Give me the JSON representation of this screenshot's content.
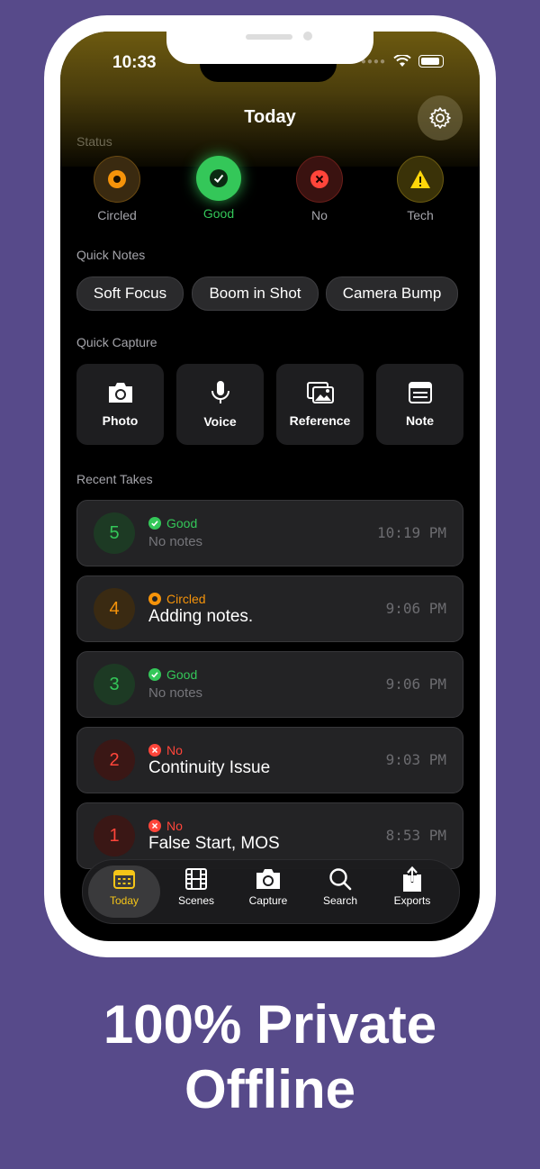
{
  "status_bar": {
    "time": "10:33"
  },
  "header": {
    "title": "Today"
  },
  "status_section": {
    "label": "Status",
    "items": [
      {
        "label": "Circled",
        "color": "#f5930a",
        "icon": "circle-dot-icon"
      },
      {
        "label": "Good",
        "color": "#34c759",
        "icon": "checkmark-icon",
        "selected": true
      },
      {
        "label": "No",
        "color": "#ff453a",
        "icon": "x-icon"
      },
      {
        "label": "Tech",
        "color": "#ffd60a",
        "icon": "warning-icon"
      }
    ]
  },
  "quick_notes": {
    "label": "Quick Notes",
    "chips": [
      "Soft Focus",
      "Boom in Shot",
      "Camera Bump"
    ]
  },
  "quick_capture": {
    "label": "Quick Capture",
    "items": [
      {
        "label": "Photo",
        "icon": "camera-icon"
      },
      {
        "label": "Voice",
        "icon": "microphone-icon"
      },
      {
        "label": "Reference",
        "icon": "photos-icon"
      },
      {
        "label": "Note",
        "icon": "note-icon"
      }
    ]
  },
  "recent_takes": {
    "label": "Recent Takes",
    "items": [
      {
        "number": "5",
        "status": "Good",
        "note": "No notes",
        "time": "10:19 PM",
        "color": "#34c759"
      },
      {
        "number": "4",
        "status": "Circled",
        "note": "Adding notes.",
        "time": "9:06 PM",
        "color": "#f5930a"
      },
      {
        "number": "3",
        "status": "Good",
        "note": "No notes",
        "time": "9:06 PM",
        "color": "#34c759"
      },
      {
        "number": "2",
        "status": "No",
        "note": "Continuity Issue",
        "time": "9:03 PM",
        "color": "#ff453a"
      },
      {
        "number": "1",
        "status": "No",
        "note": "False Start, MOS",
        "time": "8:53 PM",
        "color": "#ff453a"
      }
    ]
  },
  "tabbar": {
    "tabs": [
      {
        "label": "Today",
        "icon": "calendar-icon",
        "active": true
      },
      {
        "label": "Scenes",
        "icon": "film-icon"
      },
      {
        "label": "Capture",
        "icon": "camera-icon"
      },
      {
        "label": "Search",
        "icon": "search-icon"
      },
      {
        "label": "Exports",
        "icon": "share-icon"
      }
    ]
  },
  "promo": {
    "line1": "100% Private",
    "line2": "Offline"
  },
  "colors": {
    "background": "#574a8a",
    "accent": "#f5c518"
  }
}
